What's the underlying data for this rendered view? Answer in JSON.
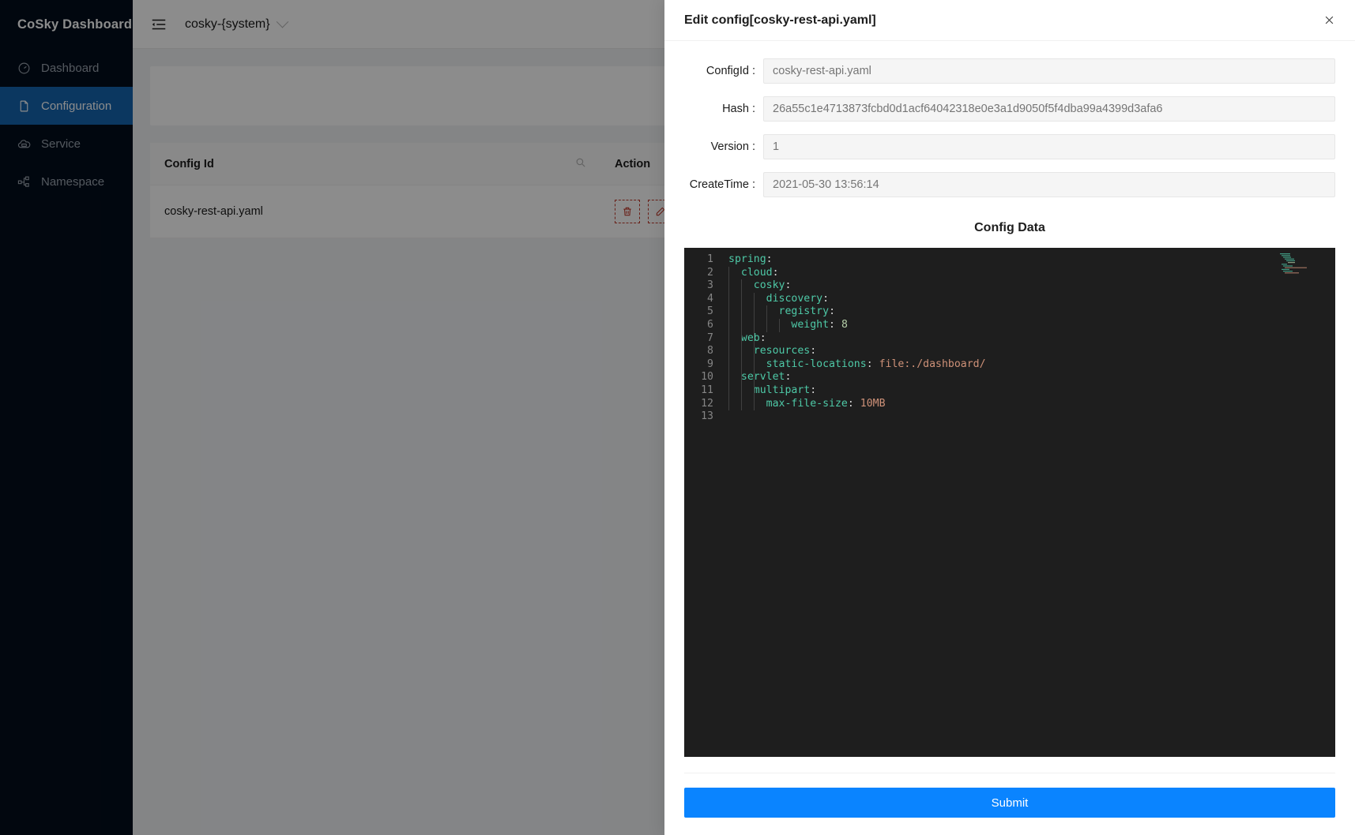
{
  "app": {
    "brand": "CoSky Dashboard",
    "sidebar": {
      "items": [
        {
          "label": "Dashboard",
          "icon": "gauge-icon",
          "active": false
        },
        {
          "label": "Configuration",
          "icon": "file-icon",
          "active": true
        },
        {
          "label": "Service",
          "icon": "cloud-server-icon",
          "active": false
        },
        {
          "label": "Namespace",
          "icon": "cluster-icon",
          "active": false
        }
      ]
    },
    "topbar": {
      "menu_icon": "menu-fold-icon",
      "namespace": "cosky-{system}",
      "namespace_caret": "chevron-down-icon"
    },
    "table": {
      "columns": [
        "Config Id",
        "Action"
      ],
      "search_icon": "search-icon",
      "rows": [
        {
          "config_id": "cosky-rest-api.yaml",
          "actions": [
            "delete-icon",
            "edit-icon"
          ]
        }
      ]
    }
  },
  "drawer": {
    "title": "Edit config[cosky-rest-api.yaml]",
    "close_icon": "close-icon",
    "fields": [
      {
        "label": "ConfigId",
        "value": "cosky-rest-api.yaml"
      },
      {
        "label": "Hash",
        "value": "26a55c1e4713873fcbd0d1acf64042318e0e3a1d9050f5f4dba99a4399d3afa6"
      },
      {
        "label": "Version",
        "value": "1"
      },
      {
        "label": "CreateTime",
        "value": "2021-05-30 13:56:14"
      }
    ],
    "config_data_title": "Config Data",
    "editor": {
      "line_numbers": [
        "1",
        "2",
        "3",
        "4",
        "5",
        "6",
        "7",
        "8",
        "9",
        "10",
        "11",
        "12",
        "13"
      ],
      "lines": [
        {
          "indent": 0,
          "key": "spring",
          "value": "",
          "type": "plain"
        },
        {
          "indent": 1,
          "key": "cloud",
          "value": "",
          "type": "plain"
        },
        {
          "indent": 2,
          "key": "cosky",
          "value": "",
          "type": "plain"
        },
        {
          "indent": 3,
          "key": "discovery",
          "value": "",
          "type": "plain"
        },
        {
          "indent": 4,
          "key": "registry",
          "value": "",
          "type": "plain"
        },
        {
          "indent": 5,
          "key": "weight",
          "value": "8",
          "type": "number"
        },
        {
          "indent": 1,
          "key": "web",
          "value": "",
          "type": "plain"
        },
        {
          "indent": 2,
          "key": "resources",
          "value": "",
          "type": "plain"
        },
        {
          "indent": 3,
          "key": "static-locations",
          "value": "file:./dashboard/",
          "type": "string"
        },
        {
          "indent": 1,
          "key": "servlet",
          "value": "",
          "type": "plain"
        },
        {
          "indent": 2,
          "key": "multipart",
          "value": "",
          "type": "plain"
        },
        {
          "indent": 3,
          "key": "max-file-size",
          "value": "10MB",
          "type": "string"
        },
        {
          "indent": 0,
          "key": "",
          "value": "",
          "type": "empty"
        }
      ],
      "raw": "spring:\n  cloud:\n    cosky:\n      discovery:\n        registry:\n          weight: 8\n  web:\n    resources:\n      static-locations: file:./dashboard/\n  servlet:\n    multipart:\n      max-file-size: 10MB\n"
    },
    "submit_label": "Submit"
  },
  "colors": {
    "accent": "#1465b0",
    "submit": "#0a84ff",
    "sidebar_bg": "#030d1c",
    "editor_bg": "#1e1e1e",
    "key": "#4ec9a7",
    "string": "#ce9178",
    "number": "#b5cea8",
    "danger": "#c0392b"
  }
}
